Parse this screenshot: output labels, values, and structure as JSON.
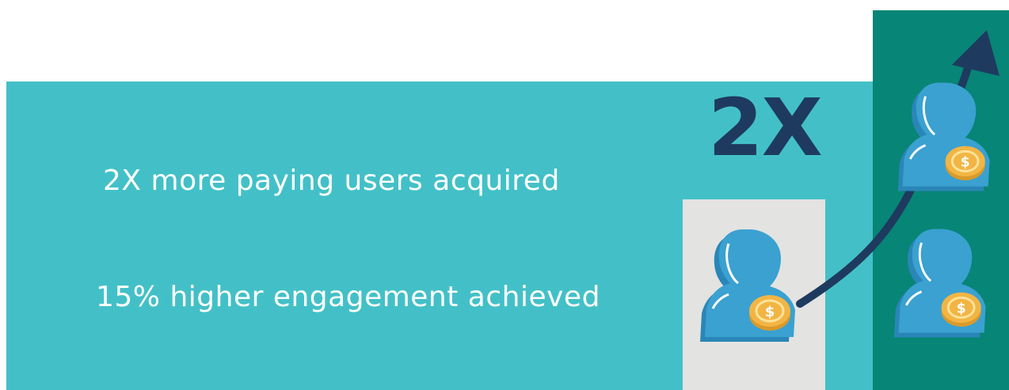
{
  "stats": {
    "line1": "2X more paying users acquired",
    "line2": "15% higher engagement achieved"
  },
  "multiplier": "2X",
  "colors": {
    "banner": "#43c0c7",
    "text": "#ffffff",
    "multiplier": "#1e3a5f",
    "before_column": "#e3e3e1",
    "after_column": "#078576",
    "user_icon": "#3aa1d1",
    "coin": "#f2b544",
    "arrow": "#1e3a5f"
  },
  "icons": {
    "user": "user-with-coin-icon",
    "arrow": "growth-arrow-icon"
  }
}
